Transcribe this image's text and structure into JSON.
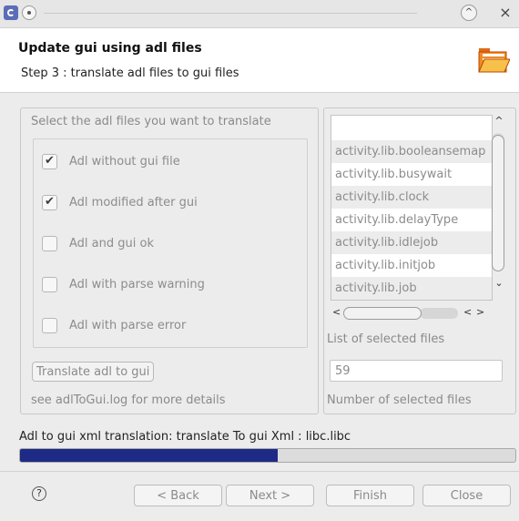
{
  "window": {
    "app_icon": "eclipse-icon",
    "menu_icon": "window-menu-icon",
    "maximize_icon": "maximize-icon",
    "close_icon": "close-icon",
    "maximize_glyph": "^",
    "close_glyph": "×"
  },
  "header": {
    "title": "Update gui using adl files",
    "subtitle": "Step 3 : translate adl files to gui files",
    "icon": "folder-icon"
  },
  "left_panel": {
    "title": "Select the adl files you want to translate",
    "checkboxes": [
      {
        "label": "Adl without gui file",
        "checked": true
      },
      {
        "label": "Adl modified after gui",
        "checked": true
      },
      {
        "label": "Adl and gui ok",
        "checked": false
      },
      {
        "label": "Adl with parse warning",
        "checked": false
      },
      {
        "label": "Adl with parse error",
        "checked": false
      }
    ],
    "translate_button": "Translate adl to gui",
    "log_hint": "see adlToGui.log for more details"
  },
  "right_panel": {
    "files": [
      "",
      "activity.lib.booleansemap",
      "activity.lib.busywait",
      "activity.lib.clock",
      "activity.lib.delayType",
      "activity.lib.idlejob",
      "activity.lib.initjob",
      "activity.lib.job"
    ],
    "list_label": "List of selected files",
    "count_value": "59",
    "count_label": "Number of selected files",
    "vscroll_up": "^",
    "vscroll_down": "⌄",
    "hscroll_left": "<",
    "hscroll_right": ">"
  },
  "status": {
    "text": "Adl to gui xml translation: translate To gui Xml : libc.libc",
    "progress": 0.52,
    "progress_color": "#1d2a86"
  },
  "footer": {
    "help_icon": "help-icon",
    "help_glyph": "?",
    "back_label": "< Back",
    "next_label": "Next >",
    "finish_label": "Finish",
    "close_label": "Close"
  }
}
